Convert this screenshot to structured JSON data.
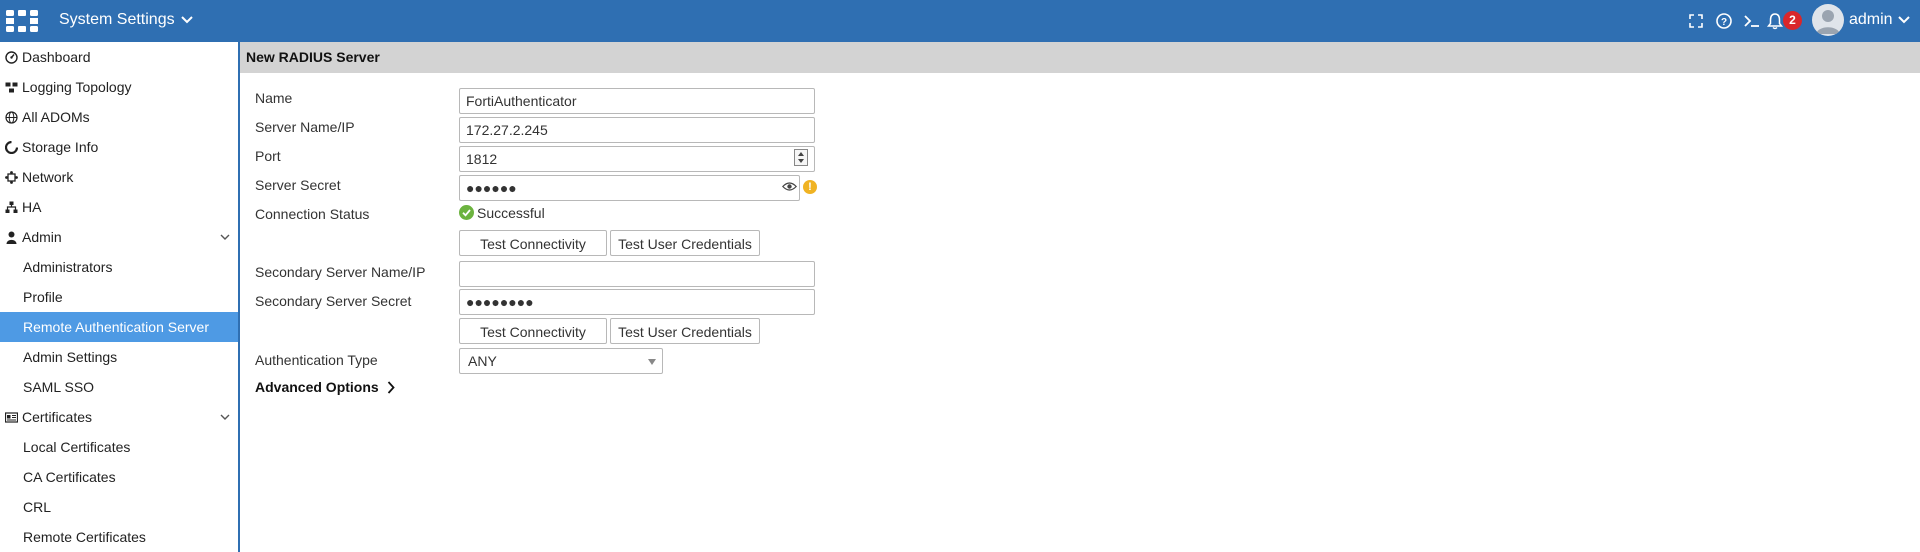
{
  "colors": {
    "topbar": "#2f6fb2",
    "active_nav": "#4e9ae4",
    "badge": "#d9262b",
    "success": "#6cb33f",
    "warning": "#f0b323"
  },
  "topbar": {
    "app_title": "System Settings",
    "icons": [
      "fullscreen-icon",
      "help-icon",
      "cli-console-icon",
      "notification-bell-icon"
    ],
    "notification_count": "2",
    "user_name": "admin"
  },
  "sidebar": {
    "items": [
      {
        "label": "Dashboard",
        "icon": "dashboard-icon"
      },
      {
        "label": "Logging Topology",
        "icon": "topology-icon"
      },
      {
        "label": "All ADOMs",
        "icon": "globe-icon"
      },
      {
        "label": "Storage Info",
        "icon": "storage-icon"
      },
      {
        "label": "Network",
        "icon": "network-icon"
      },
      {
        "label": "HA",
        "icon": "ha-icon"
      },
      {
        "label": "Admin",
        "icon": "user-icon",
        "expanded": true
      },
      {
        "label": "Administrators"
      },
      {
        "label": "Profile"
      },
      {
        "label": "Remote Authentication Server",
        "active": true
      },
      {
        "label": "Admin Settings"
      },
      {
        "label": "SAML SSO"
      },
      {
        "label": "Certificates",
        "icon": "certificate-icon",
        "expanded": true
      },
      {
        "label": "Local Certificates"
      },
      {
        "label": "CA Certificates"
      },
      {
        "label": "CRL"
      },
      {
        "label": "Remote Certificates"
      }
    ]
  },
  "page": {
    "title": "New RADIUS Server"
  },
  "form": {
    "name": {
      "label": "Name",
      "value": "FortiAuthenticator"
    },
    "server": {
      "label": "Server Name/IP",
      "value": "172.27.2.245"
    },
    "port": {
      "label": "Port",
      "value": "1812"
    },
    "secret": {
      "label": "Server Secret",
      "value": "●●●●●●"
    },
    "connection_status": {
      "label": "Connection Status",
      "value": "Successful"
    },
    "test_connectivity": "Test Connectivity",
    "test_user_credentials": "Test User Credentials",
    "secondary_server": {
      "label": "Secondary Server Name/IP",
      "value": ""
    },
    "secondary_secret": {
      "label": "Secondary Server Secret",
      "value": "●●●●●●●●"
    },
    "auth_type": {
      "label": "Authentication Type",
      "value": "ANY"
    },
    "advanced_options": "Advanced Options"
  }
}
